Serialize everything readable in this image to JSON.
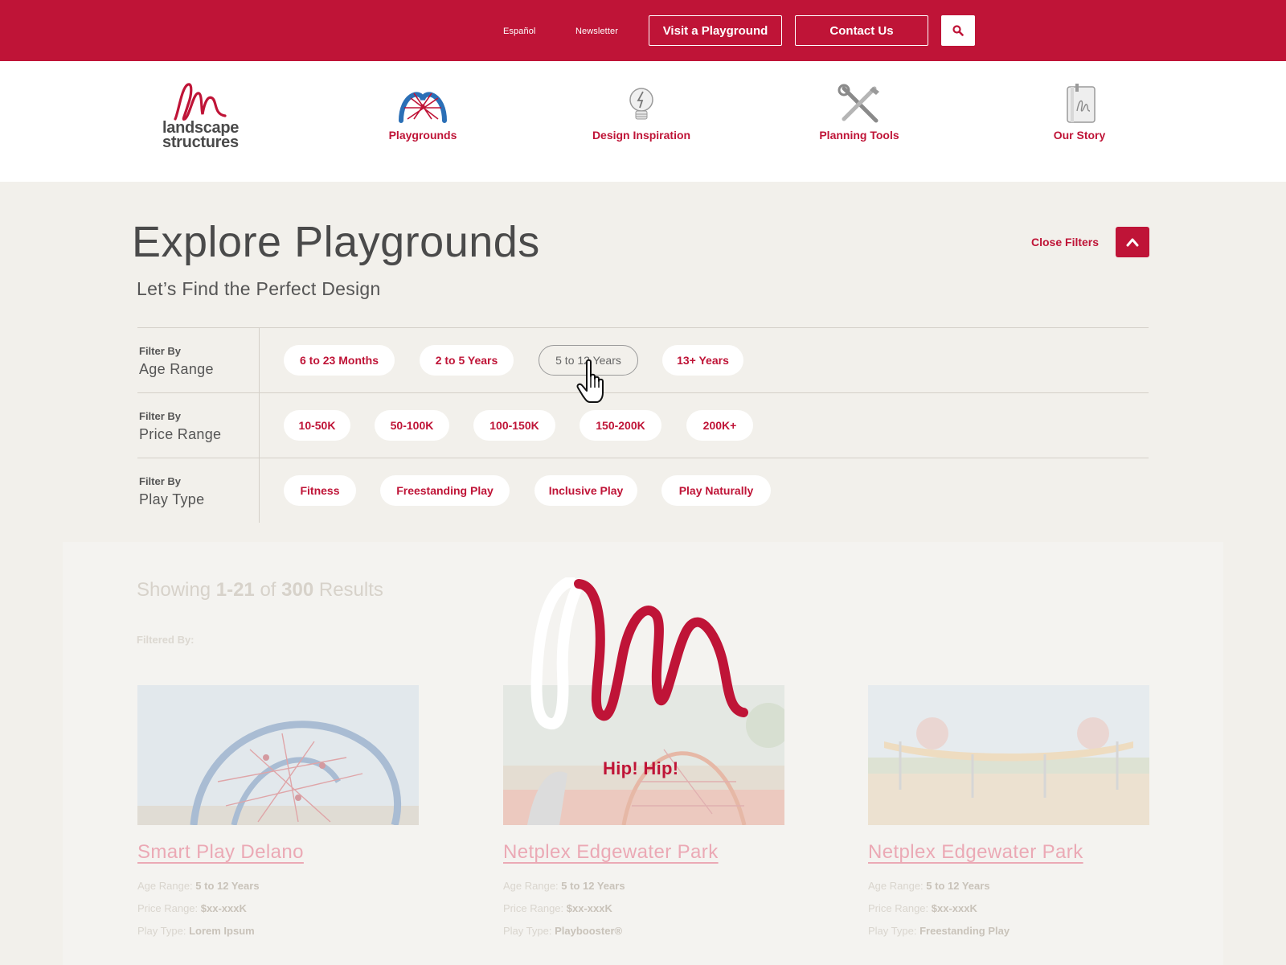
{
  "topbar": {
    "links": [
      "Español",
      "Newsletter"
    ],
    "buttons": [
      "Visit a Playground",
      "Contact Us"
    ],
    "search_icon": "search-icon"
  },
  "brand": {
    "line1": "landscape",
    "line2": "structures"
  },
  "nav": [
    {
      "label": "Playgrounds",
      "icon": "dome-icon"
    },
    {
      "label": "Design Inspiration",
      "icon": "lightbulb-icon"
    },
    {
      "label": "Planning Tools",
      "icon": "tools-icon"
    },
    {
      "label": "Our Story",
      "icon": "book-icon"
    }
  ],
  "heading": {
    "title": "Explore Playgrounds",
    "subtitle": "Let’s Find the Perfect Design",
    "close_filters": "Close Filters"
  },
  "filters": [
    {
      "by": "Filter By",
      "name": "Age Range",
      "options": [
        "6 to 23 Months",
        "2 to 5 Years",
        "5 to 12 Years",
        "13+ Years"
      ],
      "selected": "5 to 12 Years"
    },
    {
      "by": "Filter By",
      "name": "Price Range",
      "options": [
        "10-50K",
        "50-100K",
        "100-150K",
        "150-200K",
        "200K+"
      ]
    },
    {
      "by": "Filter By",
      "name": "Play Type",
      "options": [
        "Fitness",
        "Freestanding Play",
        "Inclusive Play",
        "Play Naturally"
      ]
    }
  ],
  "results": {
    "showing_prefix": "Showing",
    "range": "1-21",
    "of": "of",
    "total": "300",
    "suffix": "Results",
    "filtered_by": "Filtered By:"
  },
  "cards": [
    {
      "title": "Smart Play Delano",
      "age_label": "Age Range:",
      "age": "5 to 12 Years",
      "price_label": "Price Range:",
      "price": "$xx-xxxK",
      "type_label": "Play Type:",
      "type": "Lorem Ipsum"
    },
    {
      "title": "Netplex Edgewater Park",
      "age_label": "Age Range:",
      "age": "5 to 12 Years",
      "price_label": "Price Range:",
      "price": "$xx-xxxK",
      "type_label": "Play Type:",
      "type": "Playbooster®"
    },
    {
      "title": "Netplex Edgewater Park",
      "age_label": "Age Range:",
      "age": "5 to 12 Years",
      "price_label": "Price Range:",
      "price": "$xx-xxxK",
      "type_label": "Play Type:",
      "type": "Freestanding Play"
    }
  ],
  "loader": {
    "text": "Hip! Hip!"
  },
  "colors": {
    "brand_red": "#bf1437",
    "background": "#f2f0eb"
  }
}
